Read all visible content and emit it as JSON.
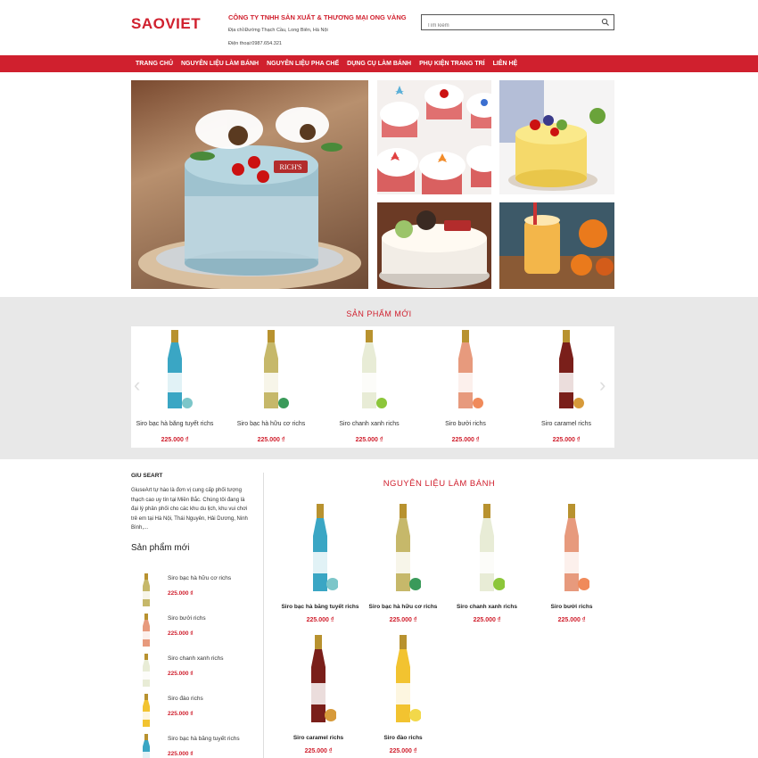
{
  "header": {
    "logo": "SAOVIET",
    "company_name": "CÔNG TY TNHH  SẢN XUẤT & THƯƠNG MẠI ONG VÀNG",
    "address": "Địa chỉ:Đường Thạch Cầu, Long Biên, Hà Nội",
    "phone": "Điện thoại:0987.654.321",
    "search_placeholder": "Tìm kiếm"
  },
  "nav": {
    "items": [
      "TRANG CHỦ",
      "NGUYÊN LIỆU LÀM BÁNH",
      "NGUYÊN LIỆU PHA CHẾ",
      "DỤNG CỤ LÀM BÁNH",
      "PHỤ KIỆN TRANG TRÍ",
      "LIÊN HỆ"
    ]
  },
  "banner": {
    "main_label": "RICH'S"
  },
  "new_products": {
    "title": "SẢN PHẨM MỚI",
    "items": [
      {
        "name": "Siro bạc hà băng tuyết richs",
        "price": "225.000 ₫",
        "color": "#3aa6c4"
      },
      {
        "name": "Siro bạc hà hữu cơ richs",
        "price": "225.000 ₫",
        "color": "#c6b86a"
      },
      {
        "name": "Siro chanh xanh richs",
        "price": "225.000 ₫",
        "color": "#e8ecd6"
      },
      {
        "name": "Siro bưởi richs",
        "price": "225.000 ₫",
        "color": "#e79a7d"
      },
      {
        "name": "Siro caramel richs",
        "price": "225.000 ₫",
        "color": "#7a1f1a"
      }
    ]
  },
  "sidebar": {
    "title": "GIU SEART",
    "about": "GiuseArt tự hào là đơn vị cung cấp phối tượng thạch cao uy tín tại Miền Bắc. Chúng tôi đang là đại lý phân phối cho các khu du lịch, khu vui chơi trẻ em tại Hà Nội, Thái Nguyên, Hải Dương, Ninh Bình,...",
    "new_title": "Sản phẩm mới",
    "items": [
      {
        "name": "Siro bạc hà hữu cơ richs",
        "price": "225.000 ₫",
        "color": "#c6b86a"
      },
      {
        "name": "Siro bưởi richs",
        "price": "225.000 ₫",
        "color": "#e79a7d"
      },
      {
        "name": "Siro chanh xanh richs",
        "price": "225.000 ₫",
        "color": "#e8ecd6"
      },
      {
        "name": "Siro đào richs",
        "price": "225.000 ₫",
        "color": "#f2c330"
      },
      {
        "name": "Siro bạc hà băng tuyết richs",
        "price": "225.000 ₫",
        "color": "#3aa6c4"
      }
    ]
  },
  "category": {
    "title": "NGUYÊN LIỆU LÀM BÁNH",
    "items": [
      {
        "name": "Siro bạc hà băng tuyết richs",
        "price": "225.000 ₫",
        "color": "#3aa6c4"
      },
      {
        "name": "Siro bạc hà hữu cơ richs",
        "price": "225.000 ₫",
        "color": "#c6b86a"
      },
      {
        "name": "Siro chanh xanh richs",
        "price": "225.000 ₫",
        "color": "#e8ecd6"
      },
      {
        "name": "Siro bưởi richs",
        "price": "225.000 ₫",
        "color": "#e79a7d"
      },
      {
        "name": "Siro caramel richs",
        "price": "225.000 ₫",
        "color": "#7a1f1a"
      },
      {
        "name": "Siro đào richs",
        "price": "225.000 ₫",
        "color": "#f2c330"
      }
    ]
  },
  "colors": {
    "brand": "#d0202e",
    "band": "#e8e8e8"
  }
}
